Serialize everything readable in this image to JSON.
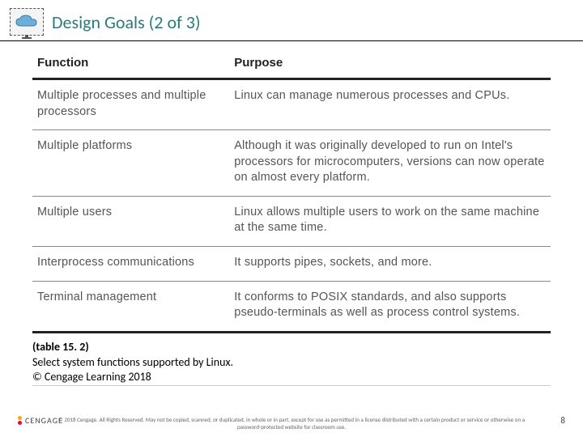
{
  "header": {
    "title": "Design Goals (2 of 3)"
  },
  "table": {
    "headers": {
      "col1": "Function",
      "col2": "Purpose"
    },
    "rows": [
      {
        "fn": "Multiple processes and multiple processors",
        "purpose": "Linux can manage numerous processes and CPUs."
      },
      {
        "fn": "Multiple platforms",
        "purpose": "Although it was originally developed to run on Intel's processors for microcomputers, versions can now operate on almost every platform."
      },
      {
        "fn": "Multiple users",
        "purpose": "Linux allows multiple users to work on the same machine at the same time."
      },
      {
        "fn": "Interprocess communications",
        "purpose": "It supports pipes, sockets, and more."
      },
      {
        "fn": "Terminal management",
        "purpose": "It conforms to POSIX standards, and also supports pseudo-terminals as well as process control systems."
      }
    ]
  },
  "caption": {
    "ref": "(table 15. 2)",
    "line1": "Select system functions supported by Linux.",
    "line2": "© Cengage Learning 2018"
  },
  "brand": {
    "text": "CENGAGE"
  },
  "footer": {
    "copyright": "© 2018 Cengage. All Rights Reserved. May not be copied, scanned, or duplicated, in whole or in part, except for use as permitted in a license distributed with a certain product or service or otherwise on a password-protected website for classroom use."
  },
  "page": {
    "number": "8"
  }
}
